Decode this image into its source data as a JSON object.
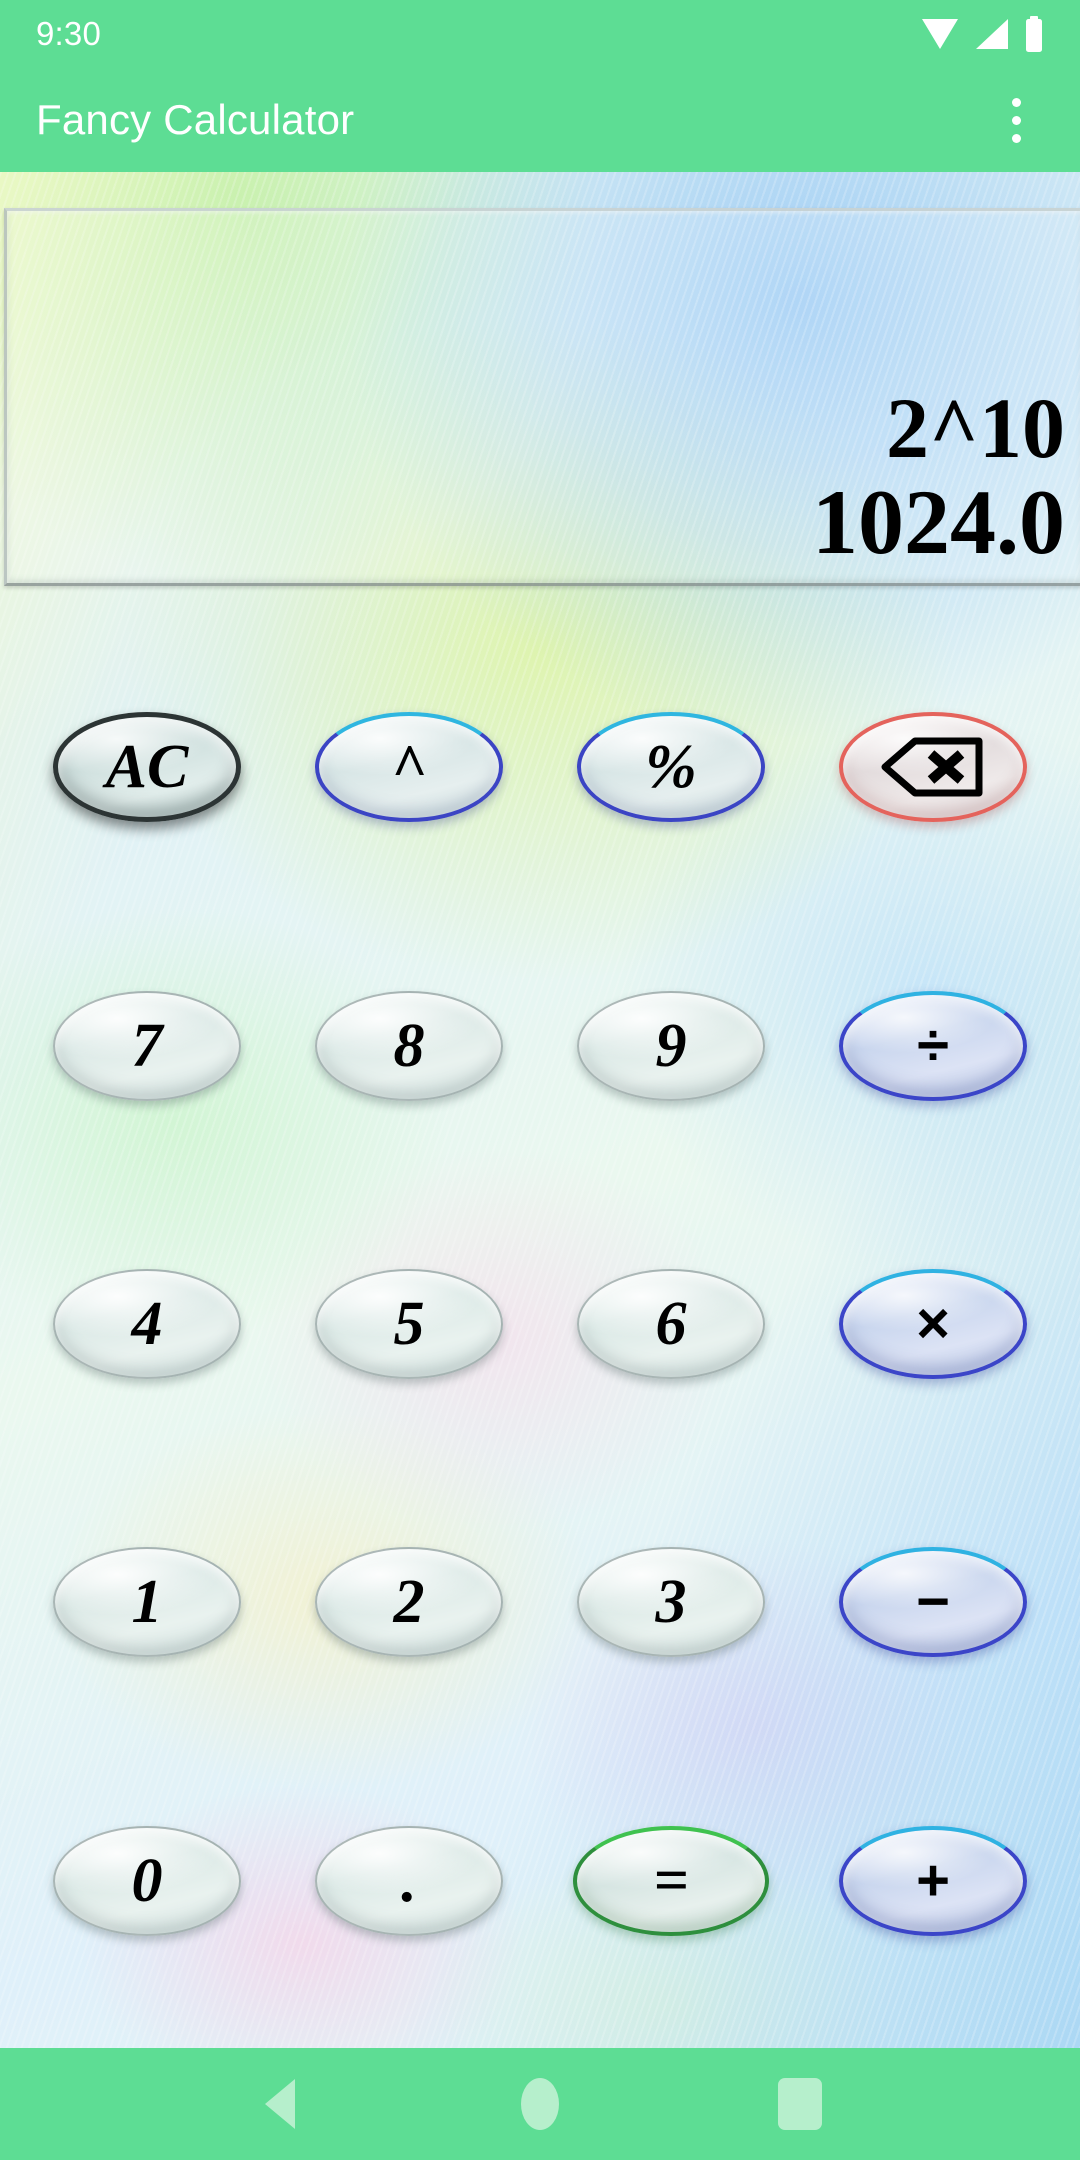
{
  "status_bar": {
    "time": "9:30",
    "icons": [
      "wifi-icon",
      "cellular-signal-icon",
      "battery-icon"
    ]
  },
  "app_bar": {
    "title": "Fancy Calculator",
    "overflow_icon": "more-vert-icon"
  },
  "display": {
    "expression": "2^10",
    "result": "1024.0"
  },
  "keypad": {
    "rows": [
      [
        {
          "label": "AC",
          "name": "all-clear",
          "style": "ac"
        },
        {
          "label": "^",
          "name": "power",
          "style": "blue-rim"
        },
        {
          "label": "%",
          "name": "percent",
          "style": "blue-rim"
        },
        {
          "label": "",
          "name": "backspace",
          "style": "red-rim",
          "icon": "backspace-icon"
        }
      ],
      [
        {
          "label": "7",
          "name": "digit-7",
          "style": "digit"
        },
        {
          "label": "8",
          "name": "digit-8",
          "style": "digit"
        },
        {
          "label": "9",
          "name": "digit-9",
          "style": "digit"
        },
        {
          "label": "÷",
          "name": "divide",
          "style": "op"
        }
      ],
      [
        {
          "label": "4",
          "name": "digit-4",
          "style": "digit"
        },
        {
          "label": "5",
          "name": "digit-5",
          "style": "digit"
        },
        {
          "label": "6",
          "name": "digit-6",
          "style": "digit"
        },
        {
          "label": "×",
          "name": "multiply",
          "style": "op"
        }
      ],
      [
        {
          "label": "1",
          "name": "digit-1",
          "style": "digit"
        },
        {
          "label": "2",
          "name": "digit-2",
          "style": "digit"
        },
        {
          "label": "3",
          "name": "digit-3",
          "style": "digit"
        },
        {
          "label": "−",
          "name": "subtract",
          "style": "op"
        }
      ],
      [
        {
          "label": "0",
          "name": "digit-0",
          "style": "digit"
        },
        {
          "label": ".",
          "name": "decimal-point",
          "style": "digit"
        },
        {
          "label": "=",
          "name": "equals",
          "style": "eq"
        },
        {
          "label": "+",
          "name": "add",
          "style": "op"
        }
      ]
    ]
  },
  "nav_bar": {
    "back": "back-icon",
    "home": "home-icon",
    "recents": "recents-icon"
  },
  "colors": {
    "accent_green": "#5ddd94",
    "nav_icon": "#b6efcc",
    "operator_rim": "#3b45c8",
    "equals_rim": "#2e8f3d",
    "backspace_rim": "#e4635c",
    "ac_rim": "#2c3434",
    "display_text": "#000000"
  }
}
